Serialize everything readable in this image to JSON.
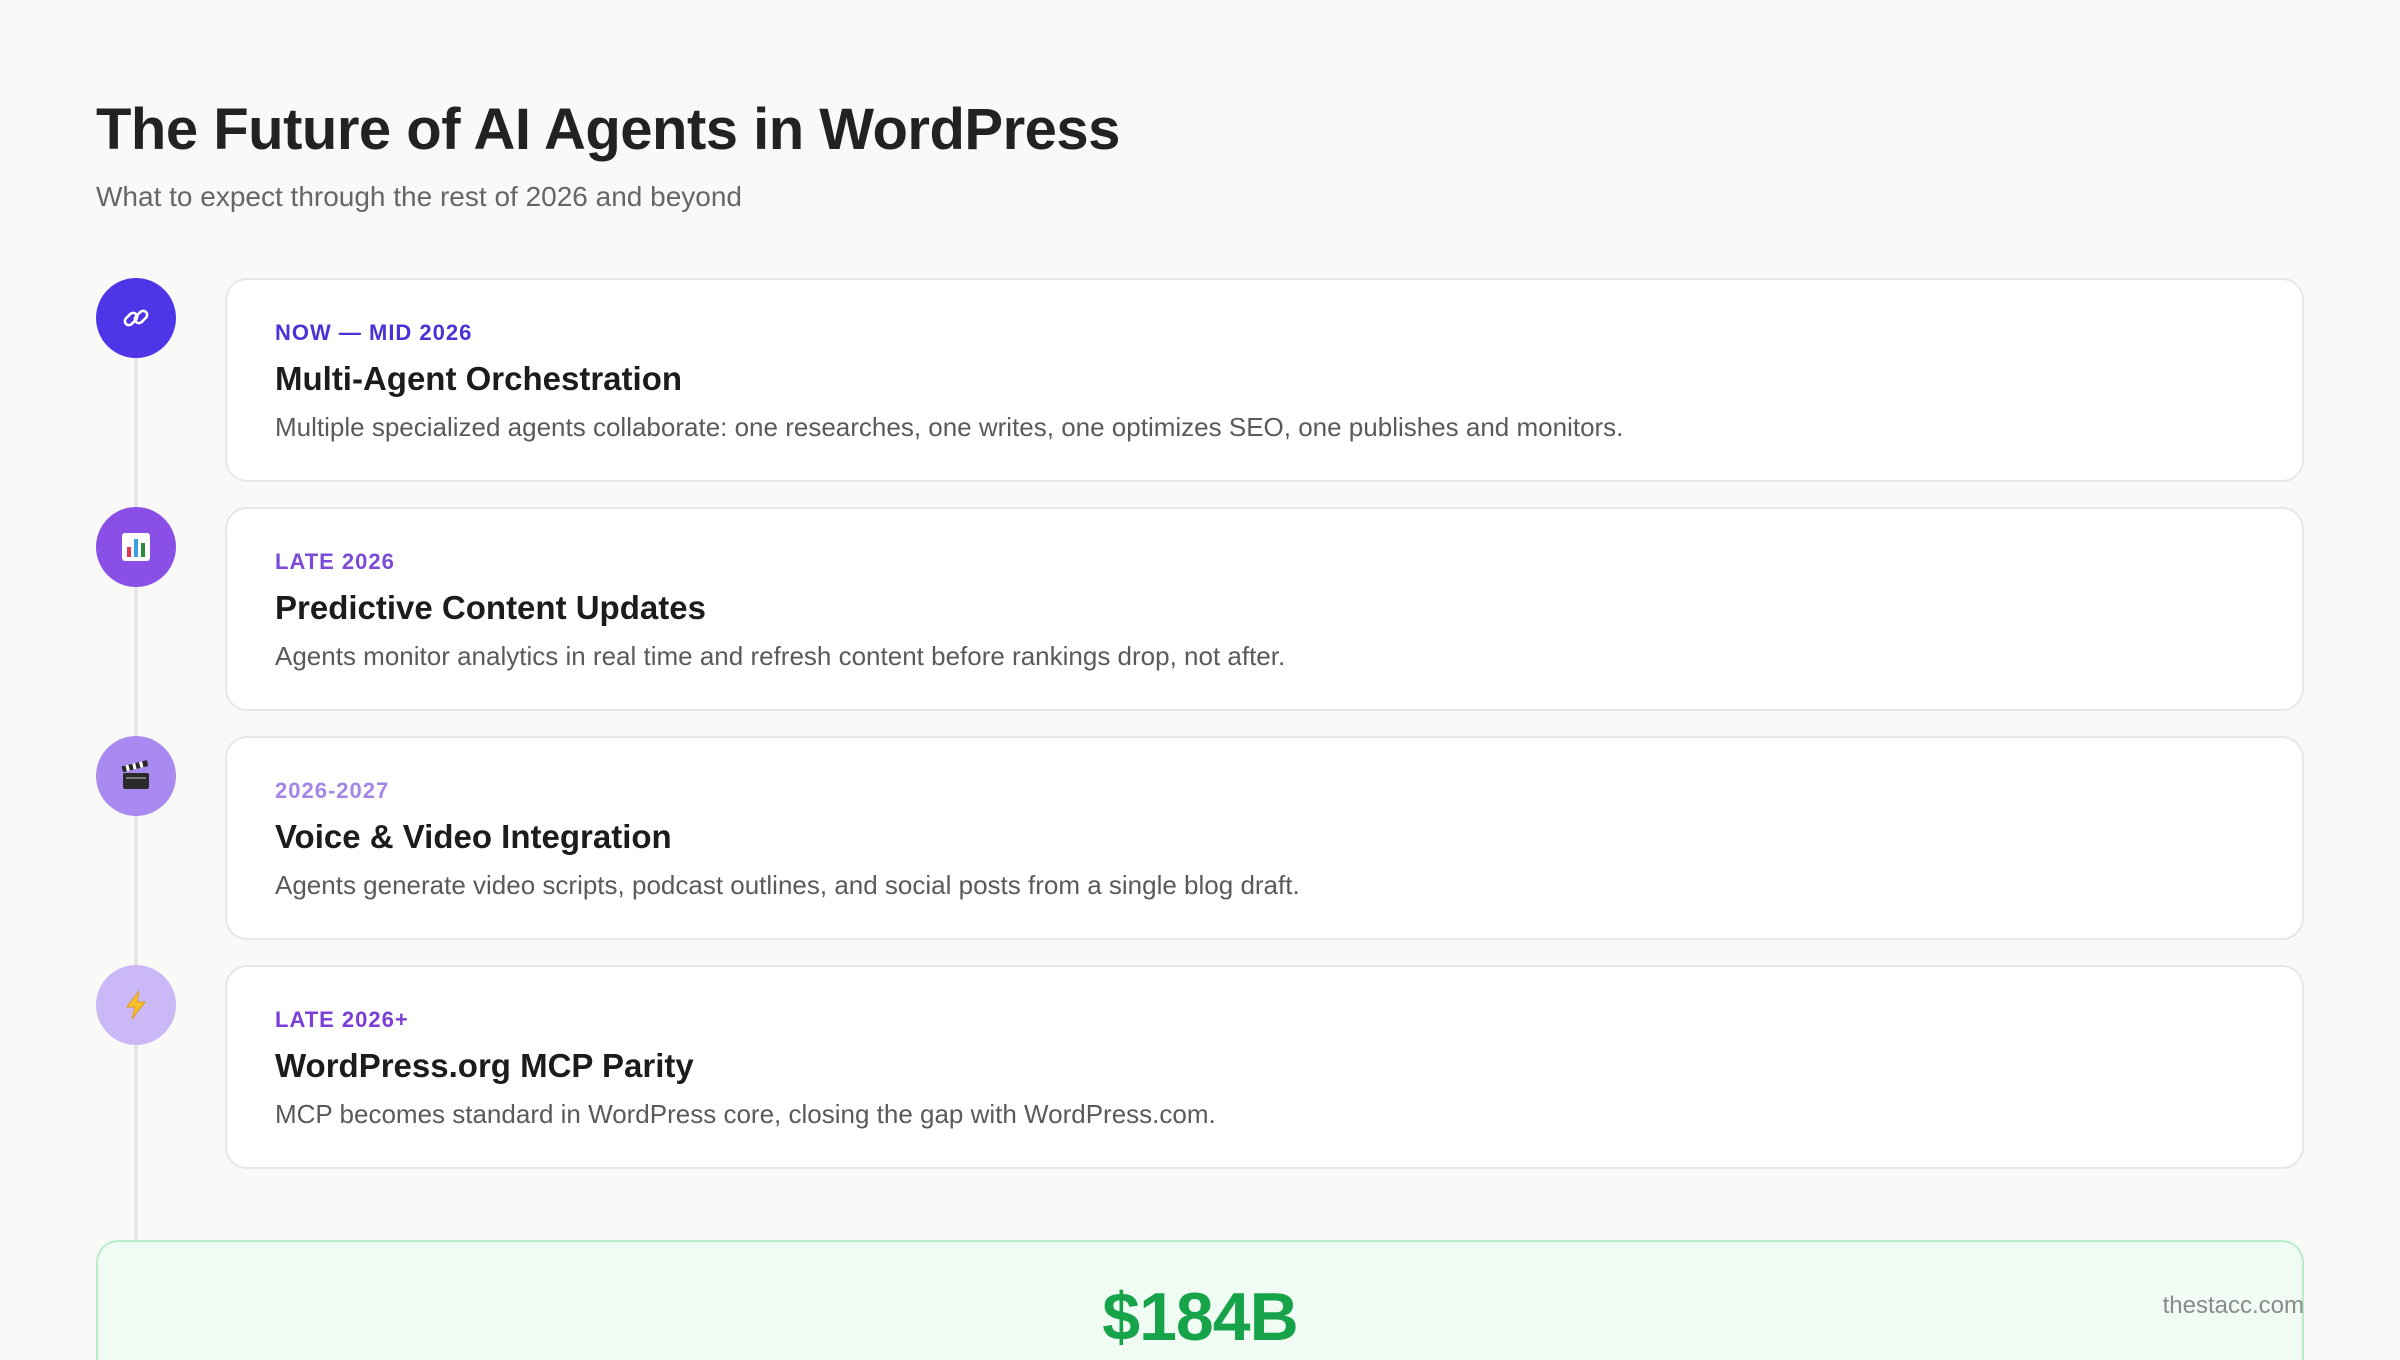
{
  "header": {
    "title": "The Future of AI Agents in WordPress",
    "subtitle": "What to expect through the rest of 2026 and beyond"
  },
  "timeline": [
    {
      "period": "NOW — MID 2026",
      "title": "Multi-Agent Orchestration",
      "description": "Multiple specialized agents collaborate: one researches, one writes, one optimizes SEO, one publishes and monitors.",
      "icon": "link-icon",
      "dot_color": "#4f35e8",
      "period_color": "#4a33d6"
    },
    {
      "period": "LATE 2026",
      "title": "Predictive Content Updates",
      "description": "Agents monitor analytics in real time and refresh content before rankings drop, not after.",
      "icon": "bar-chart-icon",
      "dot_color": "#8a4fe6",
      "period_color": "#7c4ad8"
    },
    {
      "period": "2026-2027",
      "title": "Voice & Video Integration",
      "description": "Agents generate video scripts, podcast outlines, and social posts from a single blog draft.",
      "icon": "clapperboard-icon",
      "dot_color": "#a98af0",
      "period_color": "#a586e8"
    },
    {
      "period": "LATE 2026+",
      "title": "WordPress.org MCP Parity",
      "description": "MCP becomes standard in WordPress core, closing the gap with WordPress.com.",
      "icon": "lightning-icon",
      "dot_color": "#cbb8f7",
      "period_color": "#7b3ed6"
    }
  ],
  "stat": {
    "value": "$184B",
    "color": "#17a349"
  },
  "watermark": "thestacc.com"
}
